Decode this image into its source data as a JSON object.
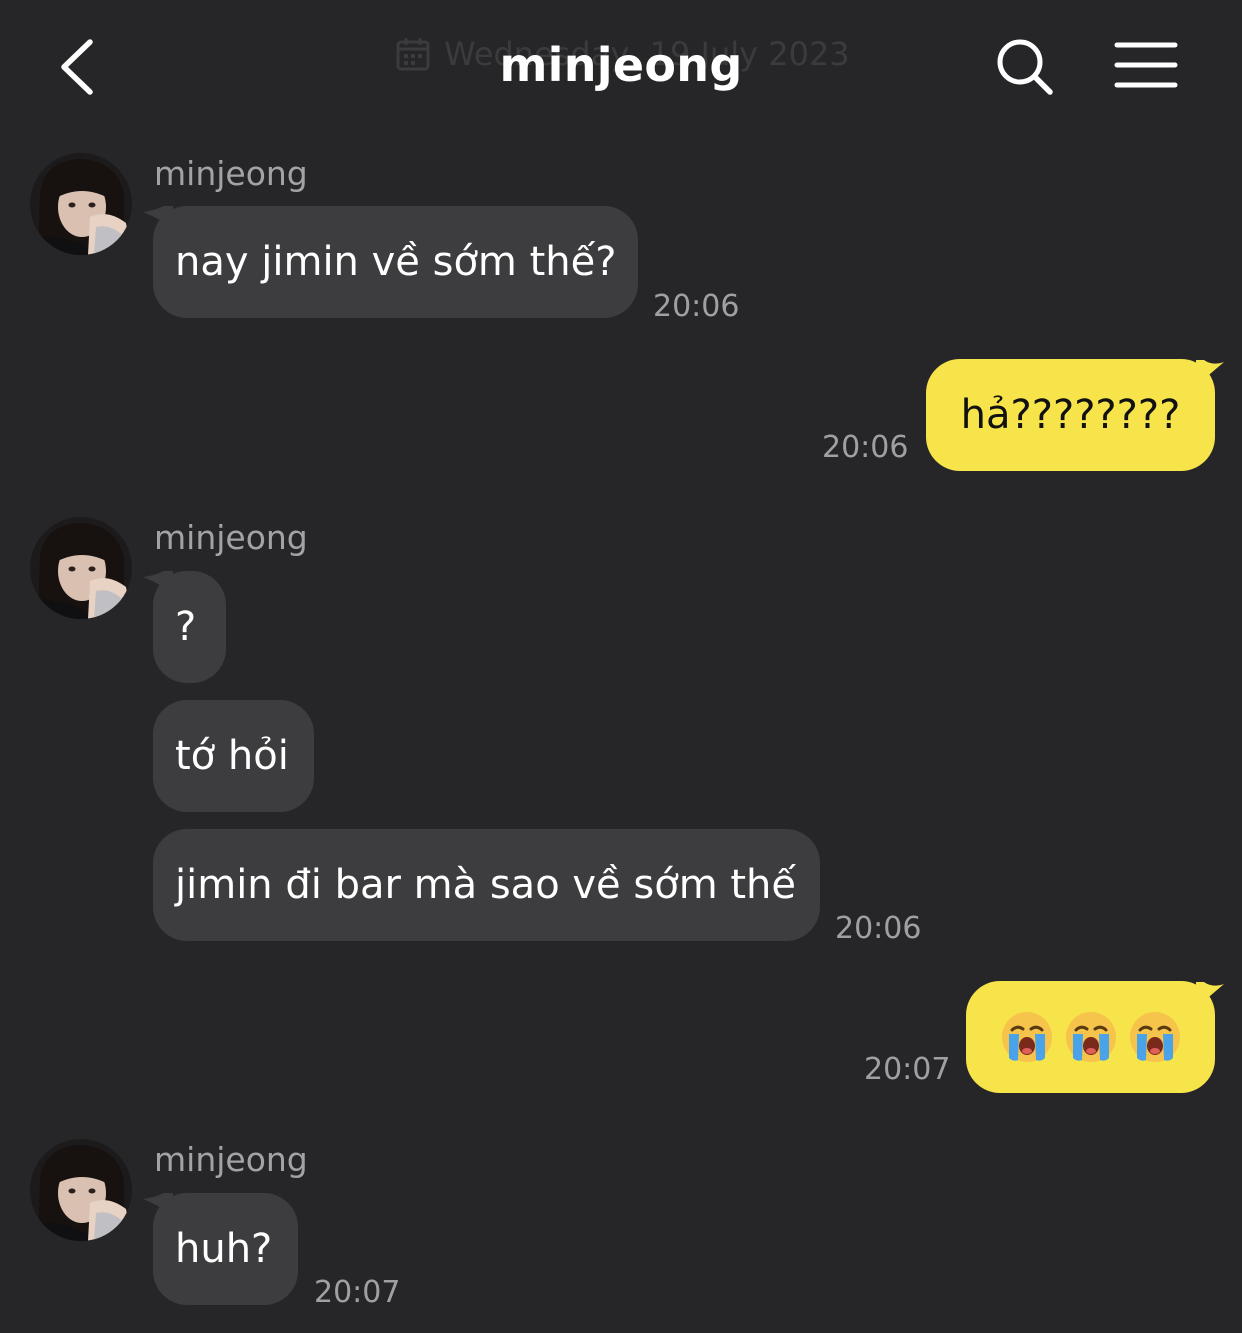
{
  "header": {
    "title": "minjeong",
    "date_text": "Wednesday, 19 July 2023",
    "back_icon": "chevron-left-icon",
    "search_icon": "search-icon",
    "menu_icon": "hamburger-menu-icon"
  },
  "colors": {
    "background": "#262628",
    "incoming_bubble": "#3d3d3f",
    "outgoing_bubble": "#f7e34a"
  },
  "messages": [
    {
      "sender": "minjeong",
      "direction": "incoming",
      "text": "nay jimin về sớm thế?",
      "time": "20:06"
    },
    {
      "direction": "outgoing",
      "text": "hả????????",
      "time": "20:06"
    },
    {
      "sender": "minjeong",
      "direction": "incoming",
      "texts": [
        "?",
        "tớ hỏi",
        "jimin đi bar mà sao về sớm thế"
      ],
      "time": "20:06"
    },
    {
      "direction": "outgoing",
      "emojis": [
        "😭",
        "😭",
        "😭"
      ],
      "emoji_name": "loudly-crying-face-emoji",
      "time": "20:07"
    },
    {
      "sender": "minjeong",
      "direction": "incoming",
      "text": "huh?",
      "time": "20:07"
    }
  ]
}
